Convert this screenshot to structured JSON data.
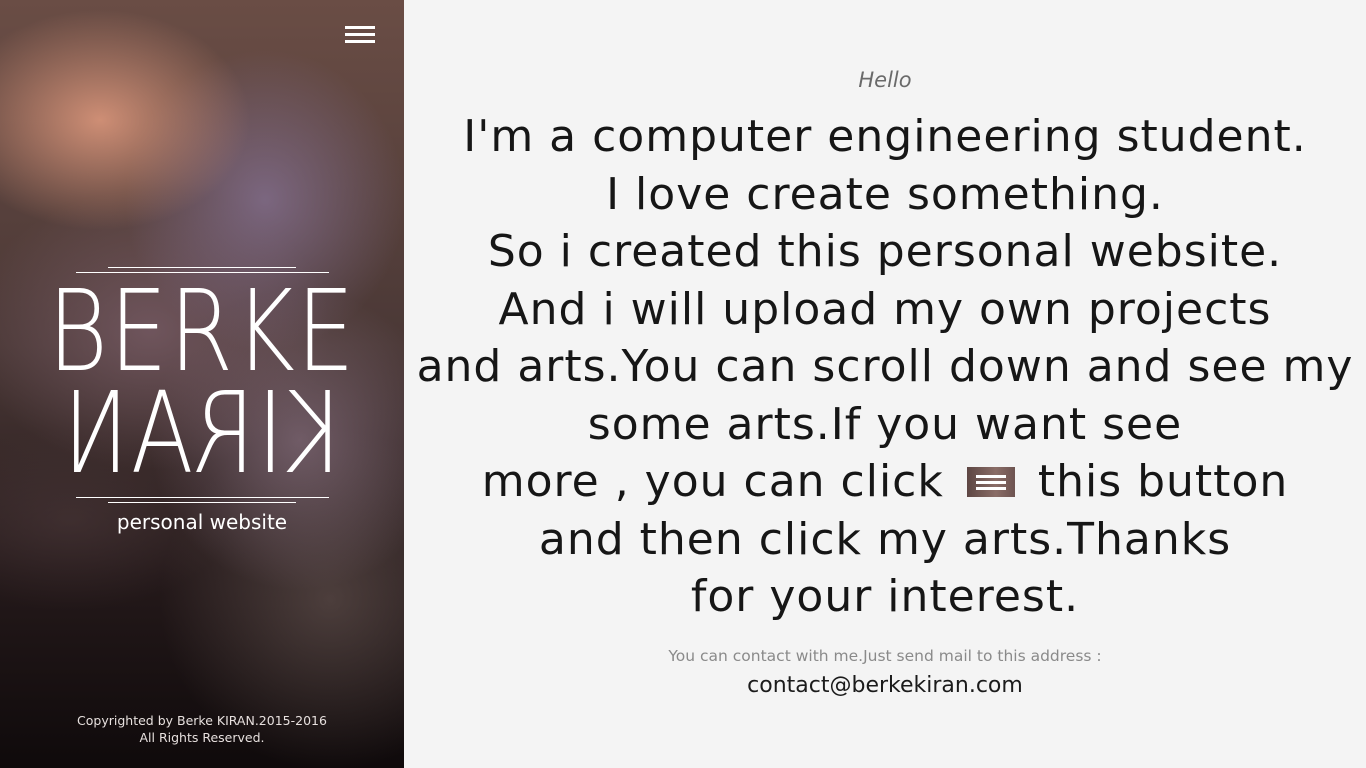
{
  "sidebar": {
    "menu_icon": "hamburger-menu-icon",
    "logo_top": "BERKE",
    "logo_bottom": "KIRAN",
    "logo_subtitle": "personal website",
    "copyright_line1": "Copyrighted by Berke KIRAN.2015-2016",
    "copyright_line2": "All Rights Reserved."
  },
  "main": {
    "greeting": "Hello",
    "bio": {
      "line1": "I'm a computer engineering student.",
      "line2": "I love create something.",
      "line3": "So i created this personal website.",
      "line4": "And i will upload my own projects",
      "line5": "and arts.You can scroll down and see my",
      "line6": "some arts.If you want see",
      "line7_before": "more , you can click",
      "line7_icon": "hamburger-menu-icon",
      "line7_after": "this button",
      "line8": "and then click my arts.Thanks",
      "line9": "for your interest."
    },
    "contact_text": "You can contact with me.Just send mail to this address :",
    "contact_email": "contact@berkekiran.com"
  }
}
